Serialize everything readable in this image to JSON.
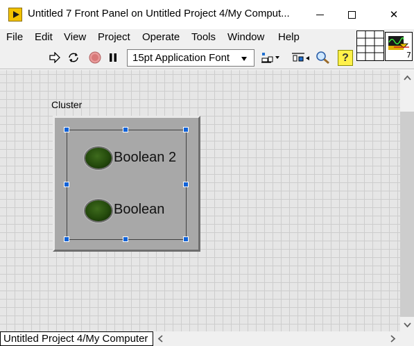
{
  "window": {
    "title": "Untitled 7 Front Panel on Untitled Project 4/My Comput...",
    "minimize_glyph": "—",
    "maximize_glyph": "☐",
    "close_glyph": "✕"
  },
  "menu": {
    "items": [
      {
        "label": "File"
      },
      {
        "label": "Edit"
      },
      {
        "label": "View"
      },
      {
        "label": "Project"
      },
      {
        "label": "Operate"
      },
      {
        "label": "Tools"
      },
      {
        "label": "Window"
      },
      {
        "label": "Help"
      }
    ]
  },
  "toolbar": {
    "font_setting": "15pt Application Font",
    "help_glyph": "?",
    "icons": [
      "run-arrow-icon",
      "run-continuously-icon",
      "abort-execution-icon",
      "pause-icon",
      "align-objects-icon",
      "distribute-objects-icon",
      "search-icon",
      "context-help-icon"
    ]
  },
  "vi_icon": {
    "number": "7"
  },
  "front_panel": {
    "cluster": {
      "label": "Cluster",
      "elements": [
        {
          "label": "Boolean 2",
          "state": "off"
        },
        {
          "label": "Boolean",
          "state": "off"
        }
      ]
    }
  },
  "status_bar": {
    "context": "Untitled Project 4/My Computer"
  },
  "colors": {
    "led_off": "#2a4f10",
    "selection_handle": "#1062d8",
    "help_highlight": "#fff14a",
    "cluster_bg": "#a8a8a8"
  }
}
